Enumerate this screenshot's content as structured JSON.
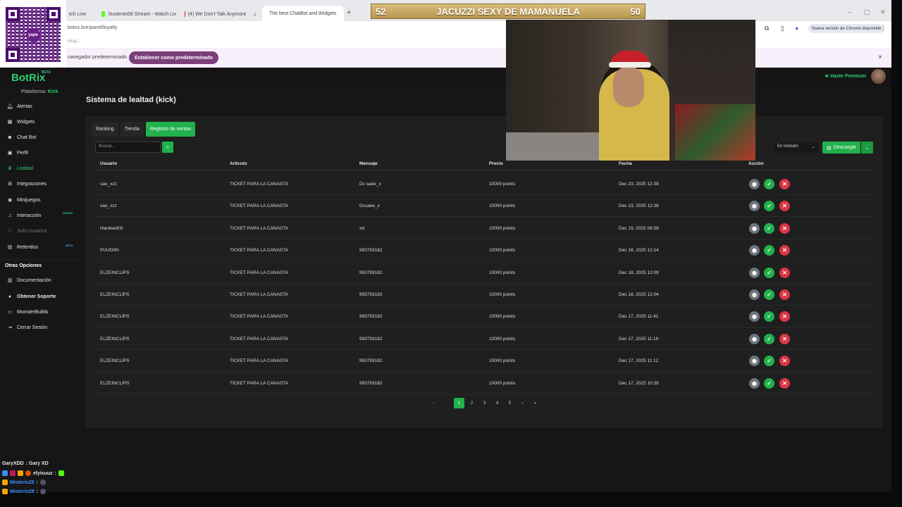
{
  "browser": {
    "tabs": [
      {
        "label": "tch Live"
      },
      {
        "label": "Sustento58 Stream - Watch Liv"
      },
      {
        "label": "(4) We Don't Talk Anymore"
      },
      {
        "label": "The best ChatBot and Widgets"
      }
    ],
    "new_tab": "+",
    "url": "botrix.live/panel/loyalty",
    "update_label": "Nueva versión de Chrome disponible",
    "bookmarks_text": "imag...",
    "infobar_text": "navegador predeterminado",
    "infobar_button": "Establecer como predeterminado",
    "close": "×"
  },
  "qr": {
    "center_label": "yape"
  },
  "stream_banner": {
    "left": "52",
    "title": "JACUZZI SEXY DE MAMANUELA",
    "right": "50"
  },
  "app": {
    "logo": "BotRix",
    "logo_badge": "BETA",
    "platform_label": "Plataforma:",
    "platform_value": "Kick",
    "premium_label": "Hazte Premium"
  },
  "sidebar": {
    "items": [
      {
        "label": "Alertas",
        "icon": "bell-icon"
      },
      {
        "label": "Widgets",
        "icon": "widgets-icon"
      },
      {
        "label": "Chat Bot",
        "icon": "robot-icon"
      },
      {
        "label": "Perfil",
        "icon": "user-icon"
      },
      {
        "label": "Lealtad",
        "icon": "loyalty-icon"
      },
      {
        "label": "Integraciones",
        "icon": "integrations-icon"
      },
      {
        "label": "Minijuegos",
        "icon": "gamepad-icon"
      },
      {
        "label": "Interacción",
        "icon": "music-icon",
        "badge": "NUEVO"
      },
      {
        "label": "Sub-Usuarios",
        "icon": "users-icon"
      },
      {
        "label": "Referidos",
        "icon": "referral-icon",
        "badge": "BETA"
      }
    ],
    "other_heading": "Otras Opciones",
    "other_items": [
      {
        "label": "Documentación",
        "icon": "book-icon"
      },
      {
        "label": "Obtener Soporte",
        "icon": "support-icon"
      },
      {
        "label": "MonsterBuilds",
        "icon": "monitor-icon"
      },
      {
        "label": "Cerrar Sesión",
        "icon": "logout-icon"
      }
    ]
  },
  "main": {
    "title": "Sistema de lealtad (kick)",
    "tabs": [
      "Ranking",
      "Tienda",
      "Registro de ventas"
    ],
    "active_tab": "Registro de ventas",
    "search_placeholder": "Buscar...",
    "status_filter": "En revisión",
    "download_label": "Descargar",
    "columns": [
      "Usuario",
      "Articulo",
      "Mensaje",
      "Precio",
      "Fecha",
      "Acción"
    ],
    "rows": [
      [
        "sae_xzz",
        "TICKET PARA LA CANASTA",
        "Dc saee_x",
        "10000 points",
        "Dec 23, 2025 12:39"
      ],
      [
        "sae_xzz",
        "TICKET PARA LA CANASTA",
        "Dcsaee_x",
        "10000 points",
        "Dec 23, 2025 12:38"
      ],
      [
        "Hardwell00",
        "TICKET PARA LA CANASTA",
        "xd",
        "10000 points",
        "Dec 19, 2025 06:58"
      ],
      [
        "PUUDIIN",
        "TICKET PARA LA CANASTA",
        "993793182",
        "10000 points",
        "Dec 18, 2025 12:14"
      ],
      [
        "ELZEINCLIPS",
        "TICKET PARA LA CANASTA",
        "993793182",
        "10000 points",
        "Dec 18, 2025 12:09"
      ],
      [
        "ELZEINCLIPS",
        "TICKET PARA LA CANASTA",
        "993793182",
        "10000 points",
        "Dec 18, 2025 12:04"
      ],
      [
        "ELZEINCLIPS",
        "TICKET PARA LA CANASTA",
        "993793182",
        "10000 points",
        "Dec 17, 2025 11:41"
      ],
      [
        "ELZEINCLIPS",
        "TICKET PARA LA CANASTA",
        "993793182",
        "10000 points",
        "Dec 17, 2025 11:19"
      ],
      [
        "ELZEINCLIPS",
        "TICKET PARA LA CANASTA",
        "993793182",
        "10000 points",
        "Dec 17, 2025 11:12"
      ],
      [
        "ELZEINCLIPS",
        "TICKET PARA LA CANASTA",
        "993793182",
        "10000 points",
        "Dec 17, 2025 10:39"
      ]
    ],
    "pagination": {
      "first": "«",
      "prev": "‹",
      "pages": [
        "1",
        "2",
        "3",
        "4",
        "5"
      ],
      "current": "1",
      "next": "›",
      "last": "»"
    }
  },
  "chat": [
    {
      "user": "GaryXDD",
      "text": ": Gary XD",
      "color": "#e6e6e6"
    },
    {
      "user": "elyisuuz",
      "text": ":",
      "color": "#e6e6e6"
    },
    {
      "user": "Misterio28",
      "text": ":",
      "color": "#3d8bff"
    },
    {
      "user": "Misterio28",
      "text": ":",
      "color": "#3d8bff"
    }
  ],
  "colors": {
    "accent": "#22b14c",
    "brand": "#2ecc71",
    "danger": "#dc3545",
    "muted": "#6c757d",
    "banner": "#c9a862"
  }
}
